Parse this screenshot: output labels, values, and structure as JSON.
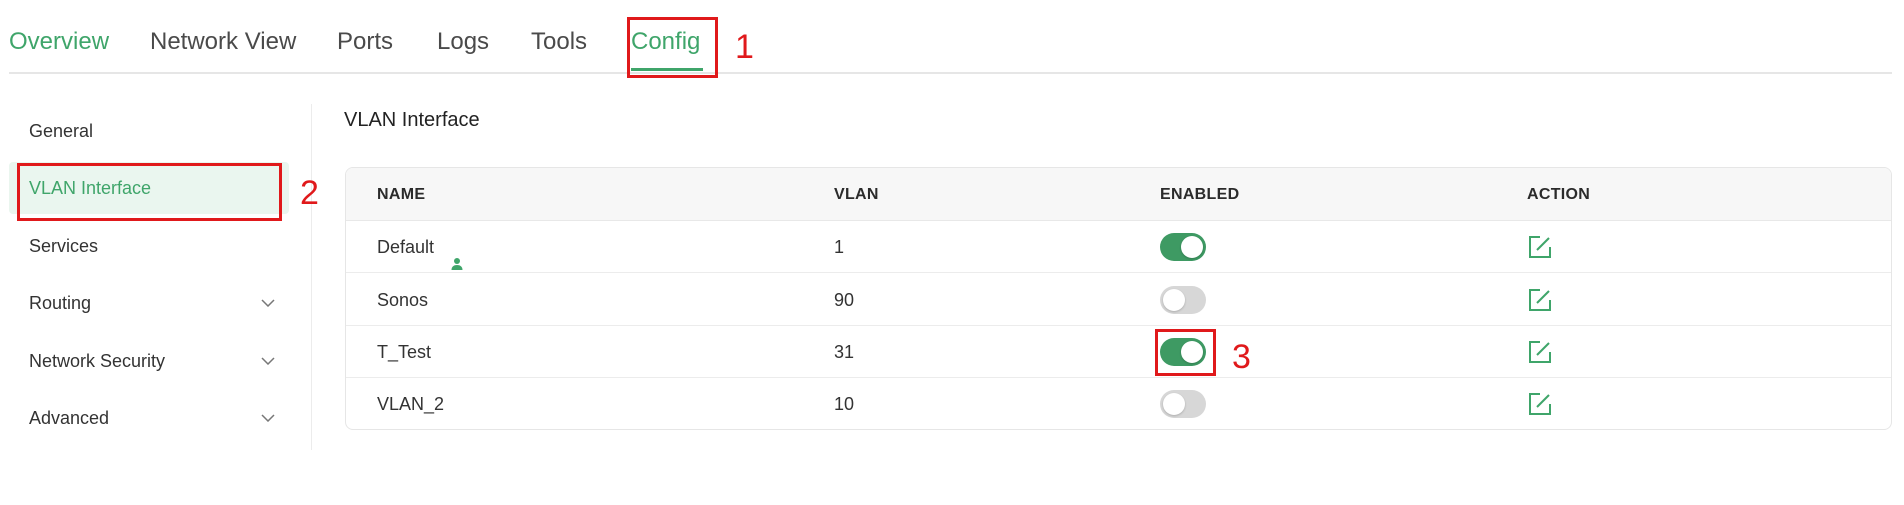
{
  "tabs": [
    {
      "label": "Overview"
    },
    {
      "label": "Network View"
    },
    {
      "label": "Ports"
    },
    {
      "label": "Logs"
    },
    {
      "label": "Tools"
    },
    {
      "label": "Config"
    }
  ],
  "annotations": [
    "1",
    "2",
    "3"
  ],
  "sidebar": {
    "items": [
      {
        "label": "General"
      },
      {
        "label": "VLAN Interface"
      },
      {
        "label": "Services"
      },
      {
        "label": "Routing"
      },
      {
        "label": "Network Security"
      },
      {
        "label": "Advanced"
      }
    ]
  },
  "main": {
    "title": "VLAN Interface",
    "columns": [
      "NAME",
      "VLAN",
      "ENABLED",
      "ACTION"
    ],
    "rows": [
      {
        "name": "Default",
        "vlan": "1",
        "enabled": true
      },
      {
        "name": "Sonos",
        "vlan": "90",
        "enabled": false
      },
      {
        "name": "T_Test",
        "vlan": "31",
        "enabled": true
      },
      {
        "name": "VLAN_2",
        "vlan": "10",
        "enabled": false
      }
    ]
  },
  "colors": {
    "accent": "#3fa56a",
    "annotation": "#e0191b",
    "toggle_on": "#3e9a63",
    "toggle_off": "#d7d7d7"
  }
}
